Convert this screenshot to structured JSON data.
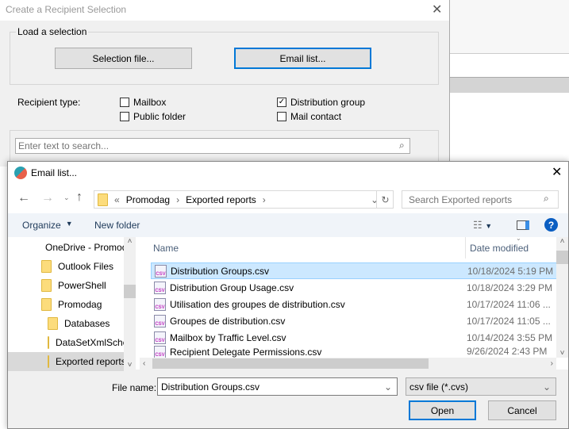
{
  "back_dialog": {
    "title": "Create a Recipient Selection",
    "load_group": "Load a selection",
    "selection_file_button": "Selection file...",
    "email_list_button": "Email list...",
    "recipient_type_label": "Recipient type:",
    "checkboxes": [
      {
        "label": "Mailbox",
        "checked": false
      },
      {
        "label": "Public folder",
        "checked": false
      },
      {
        "label": "Distribution group",
        "checked": true
      },
      {
        "label": "Mail contact",
        "checked": false
      }
    ],
    "search_placeholder": "Enter text to search..."
  },
  "file_dialog": {
    "title": "Email list...",
    "breadcrumb": [
      "Promodag",
      "Exported reports"
    ],
    "search_placeholder": "Search Exported reports",
    "toolbar": {
      "organize": "Organize",
      "new_folder": "New folder"
    },
    "tree": [
      "OneDrive - Promodag",
      "Outlook Files",
      "PowerShell",
      "Promodag",
      "Databases",
      "DataSetXmlSchemas",
      "Exported reports"
    ],
    "columns": {
      "name": "Name",
      "date": "Date modified"
    },
    "files": [
      {
        "name": "Distribution Groups.csv",
        "date": "10/18/2024 5:19 PM"
      },
      {
        "name": "Distribution Group Usage.csv",
        "date": "10/18/2024 3:29 PM"
      },
      {
        "name": "Utilisation des groupes de distribution.csv",
        "date": "10/17/2024 11:06 ..."
      },
      {
        "name": "Groupes de distribution.csv",
        "date": "10/17/2024 11:05 ..."
      },
      {
        "name": "Mailbox by Traffic Level.csv",
        "date": "10/14/2024 3:55 PM"
      },
      {
        "name": "Recipient Delegate Permissions.csv",
        "date": "9/26/2024 2:43 PM"
      }
    ],
    "file_name_label": "File name:",
    "file_name_value": "Distribution Groups.csv",
    "file_type": "csv file (*.cvs)",
    "open_button": "Open",
    "cancel_button": "Cancel"
  }
}
